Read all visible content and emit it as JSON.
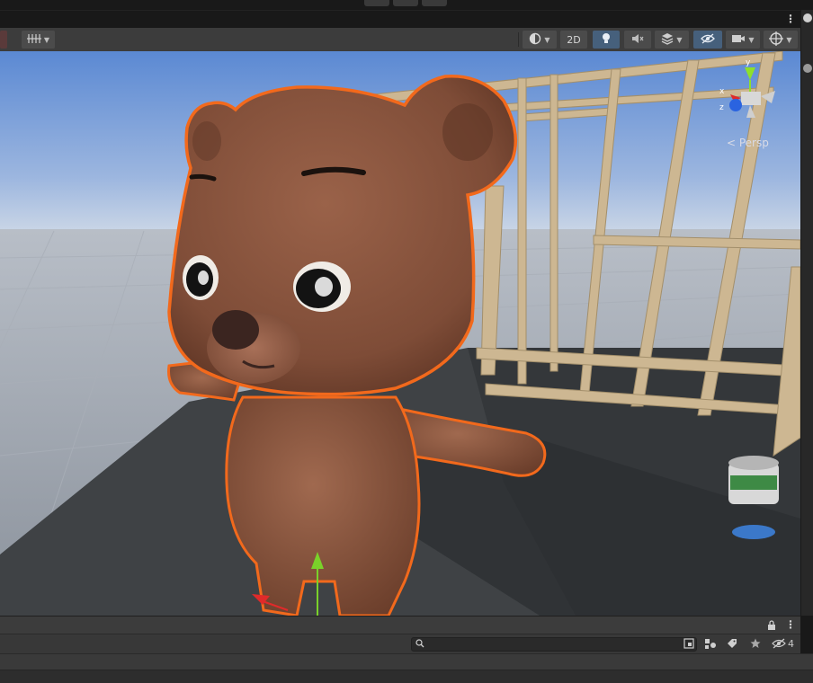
{
  "toolbar": {
    "mode_2d_label": "2D"
  },
  "scene": {
    "projection_label": "< Persp",
    "gizmo_axes": {
      "y": "y",
      "x": "x",
      "z": "z"
    }
  },
  "hierarchy": {
    "search_placeholder": "",
    "hidden_count": "4"
  },
  "icons": [
    "gizmo-shading-icon",
    "grid-icon",
    "light-icon",
    "audio-mute-icon",
    "effects-icon",
    "scene-visibility-icon",
    "camera-icon",
    "orientation-gizmo-icon",
    "lock-icon",
    "search-icon",
    "kebab-menu-icon",
    "tag-icon",
    "star-icon",
    "visibility-hidden-icon"
  ],
  "colors": {
    "selection_outline": "#f2691c",
    "toolbar_bg": "#3c3c3c",
    "active_button": "#46607c",
    "sky_top": "#5f8dd6",
    "ground": "#9aa1ac",
    "bear_fur": "#8a5640"
  }
}
